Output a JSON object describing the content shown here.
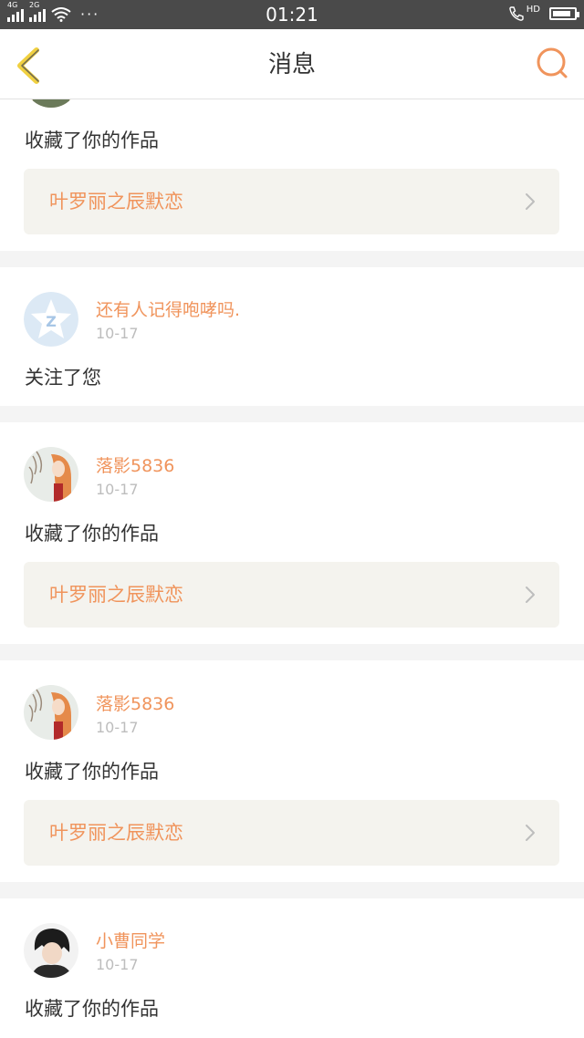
{
  "status_bar": {
    "net1": "4G",
    "net2": "2G",
    "more": "···",
    "time": "01:21",
    "hd": "HD",
    "battery_level": 0.85
  },
  "header": {
    "title": "消息"
  },
  "colors": {
    "accent": "#f0945c",
    "back_icon": "#f0d040",
    "time_text": "#bdbdbd",
    "work_bg": "#f4f3ee"
  },
  "messages": [
    {
      "action": "收藏了你的作品",
      "work_title": "叶罗丽之辰默恋",
      "avatar": "partial-avatar"
    },
    {
      "user": "还有人记得咆哮吗.",
      "time": "10-17",
      "action": "关注了您",
      "avatar": "qzone-star-icon"
    },
    {
      "user": "落影5836",
      "time": "10-17",
      "action": "收藏了你的作品",
      "work_title": "叶罗丽之辰默恋",
      "avatar": "anime-girl-avatar"
    },
    {
      "user": "落影5836",
      "time": "10-17",
      "action": "收藏了你的作品",
      "work_title": "叶罗丽之辰默恋",
      "avatar": "anime-girl-avatar"
    },
    {
      "user": "小曹同学",
      "time": "10-17",
      "action": "收藏了你的作品",
      "avatar": "dark-hair-boy-avatar"
    }
  ]
}
